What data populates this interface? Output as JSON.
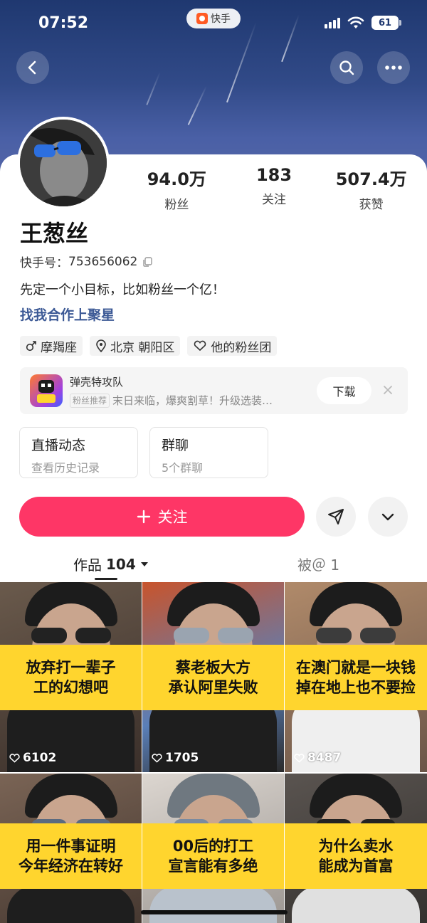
{
  "status_bar": {
    "time": "07:52",
    "app_name": "快手",
    "battery": "61"
  },
  "header": {
    "back_icon": "chevron-left-icon",
    "search_icon": "search-icon",
    "more_icon": "more-dots-icon"
  },
  "profile": {
    "name": "王葱丝",
    "kuaishou_id_label": "快手号：",
    "kuaishou_id": "753656062",
    "bio": "先定一个小目标，比如粉丝一个亿！",
    "cooperation_link": "找我合作上聚星",
    "stats": [
      {
        "value": "94.0万",
        "label": "粉丝"
      },
      {
        "value": "183",
        "label": "关注"
      },
      {
        "value": "507.4万",
        "label": "获赞"
      }
    ],
    "tags": [
      {
        "icon": "male-icon",
        "label": "摩羯座"
      },
      {
        "icon": "location-icon",
        "label": "北京 朝阳区"
      },
      {
        "icon": "heart-icon",
        "label": "他的粉丝团"
      }
    ]
  },
  "ad": {
    "title": "弹壳特攻队",
    "badge": "粉丝推荐",
    "description": "末日来临，爆爽割草！升级选装…",
    "download_label": "下载"
  },
  "entries": [
    {
      "title": "直播动态",
      "subtitle": "查看历史记录"
    },
    {
      "title": "群聊",
      "subtitle": "5个群聊"
    }
  ],
  "actions": {
    "follow_label": "关注",
    "follow_color": "#fe3666"
  },
  "tabs": {
    "works_label": "作品",
    "works_count": "104",
    "mentioned_label": "被＠ 1"
  },
  "videos": [
    {
      "caption": "放弃打一辈子\n工的幻想吧",
      "likes": "6102"
    },
    {
      "caption": "蔡老板大方\n承认阿里失败",
      "likes": "1705"
    },
    {
      "caption": "在澳门就是一块钱\n掉在地上也不要捡",
      "likes": "8487"
    },
    {
      "caption": "用一件事证明\n今年经济在转好",
      "likes": ""
    },
    {
      "caption": "00后的打工\n宣言能有多绝",
      "likes": ""
    },
    {
      "caption": "为什么卖水\n能成为首富",
      "likes": ""
    }
  ],
  "colors": {
    "caption_yellow": "#ffd52e",
    "link_blue": "#3d5a96"
  }
}
